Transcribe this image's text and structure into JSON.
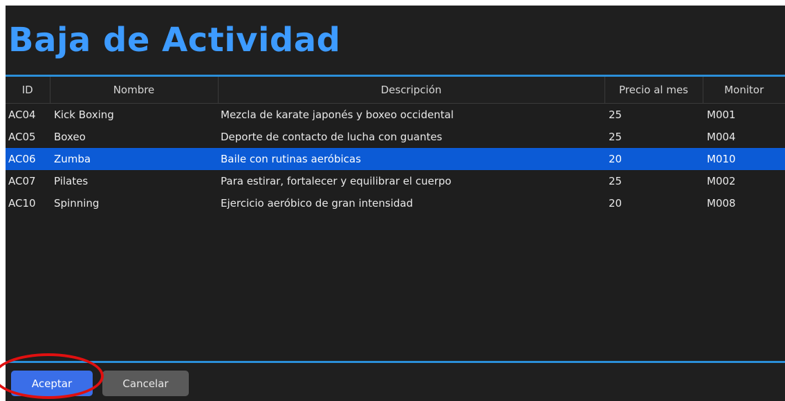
{
  "window": {
    "title": "Baja de Actividad"
  },
  "table": {
    "columns": [
      "ID",
      "Nombre",
      "Descripción",
      "Precio al mes",
      "Monitor"
    ],
    "rows": [
      {
        "id": "AC04",
        "nombre": "Kick Boxing",
        "descripcion": "Mezcla de karate japonés y boxeo occidental",
        "precio": "25",
        "monitor": "M001",
        "selected": false
      },
      {
        "id": "AC05",
        "nombre": "Boxeo",
        "descripcion": "Deporte de contacto de lucha con guantes",
        "precio": "25",
        "monitor": "M004",
        "selected": false
      },
      {
        "id": "AC06",
        "nombre": "Zumba",
        "descripcion": "Baile con rutinas aeróbicas",
        "precio": "20",
        "monitor": "M010",
        "selected": true
      },
      {
        "id": "AC07",
        "nombre": "Pilates",
        "descripcion": "Para estirar, fortalecer y equilibrar el cuerpo",
        "precio": "25",
        "monitor": "M002",
        "selected": false
      },
      {
        "id": "AC10",
        "nombre": "Spinning",
        "descripcion": "Ejercicio aeróbico de gran intensidad",
        "precio": "20",
        "monitor": "M008",
        "selected": false
      }
    ]
  },
  "footer": {
    "accept_label": "Aceptar",
    "cancel_label": "Cancelar"
  },
  "colors": {
    "title": "#3d9bff",
    "selection": "#0c5bd6",
    "accent_border": "#2b8fd9",
    "accept_button": "#3a6ee8",
    "cancel_button": "#5a5a5a",
    "annotation_ring": "#e01010"
  }
}
